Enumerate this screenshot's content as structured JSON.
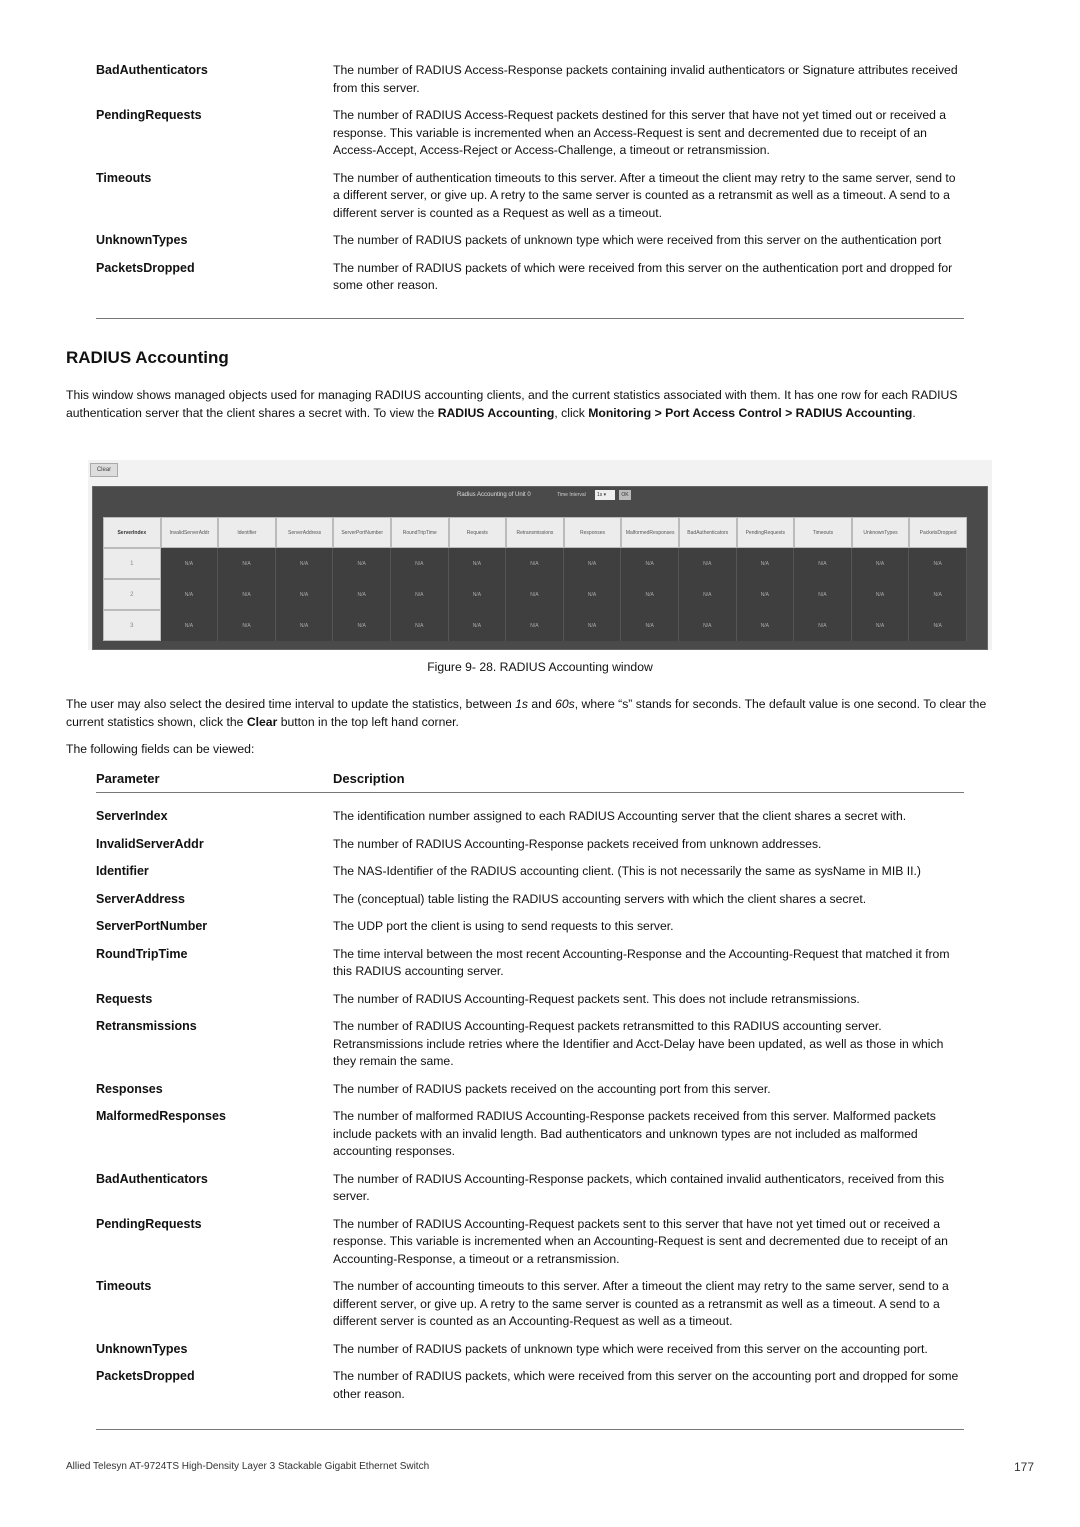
{
  "top_params": [
    {
      "name": "BadAuthenticators",
      "desc": "The number of RADIUS Access-Response packets containing invalid authenticators or Signature attributes received from this server."
    },
    {
      "name": "PendingRequests",
      "desc": "The number of RADIUS Access-Request packets destined for this server that have not yet timed out or received a response. This variable is incremented when an Access-Request is sent and decremented due to receipt of an Access-Accept, Access-Reject or Access-Challenge, a timeout or retransmission."
    },
    {
      "name": "Timeouts",
      "desc": "The number of authentication timeouts to this server. After a timeout the client may retry to the same server, send to a different server, or give up. A retry to the same server is counted as a retransmit as well as a timeout. A send to a different server is counted as a Request as well as a timeout."
    },
    {
      "name": "UnknownTypes",
      "desc": "The number of RADIUS packets of unknown type which were received from this server on the authentication port"
    },
    {
      "name": "PacketsDropped",
      "desc": "The number of RADIUS packets of which were received from this server on the authentication port and dropped for some other reason."
    }
  ],
  "section": {
    "title": "RADIUS Accounting",
    "intro_1": "This window shows managed objects used for managing RADIUS accounting clients, and the current statistics associated with them. It has one row for each RADIUS authentication server that the client shares a secret with. To view the ",
    "intro_b1": "RADIUS Accounting",
    "intro_2": ", click ",
    "intro_b2": "Monitoring > Port Access Control > RADIUS Accounting",
    "intro_3": "."
  },
  "figure": {
    "clear_label": "Clear",
    "panel_title": "Radius Accounting of Unit 0",
    "interval_label": "Time Interval",
    "interval_value": "1s",
    "ok_label": "OK",
    "columns": [
      "ServerIndex",
      "InvalidServerAddr",
      "Identifier",
      "ServerAddress",
      "ServerPortNumber",
      "RoundTripTime",
      "Requests",
      "Retransmissions",
      "Responses",
      "MalformedResponses",
      "BadAuthenticators",
      "PendingRequests",
      "Timeouts",
      "UnknownTypes",
      "PacketsDropped"
    ],
    "rows": [
      {
        "index": "1",
        "values": [
          "N/A",
          "N/A",
          "N/A",
          "N/A",
          "N/A",
          "N/A",
          "N/A",
          "N/A",
          "N/A",
          "N/A",
          "N/A",
          "N/A",
          "N/A",
          "N/A"
        ]
      },
      {
        "index": "2",
        "values": [
          "N/A",
          "N/A",
          "N/A",
          "N/A",
          "N/A",
          "N/A",
          "N/A",
          "N/A",
          "N/A",
          "N/A",
          "N/A",
          "N/A",
          "N/A",
          "N/A"
        ]
      },
      {
        "index": "3",
        "values": [
          "N/A",
          "N/A",
          "N/A",
          "N/A",
          "N/A",
          "N/A",
          "N/A",
          "N/A",
          "N/A",
          "N/A",
          "N/A",
          "N/A",
          "N/A",
          "N/A"
        ]
      }
    ],
    "caption": "Figure 9- 28. RADIUS Accounting window"
  },
  "after": {
    "p1_a": "The user may also select the desired time interval to update the statistics, between ",
    "p1_i1": "1s",
    "p1_b": " and ",
    "p1_i2": "60s",
    "p1_c": ", where “s” stands for seconds. The default value is one second. To clear the current statistics shown, click the ",
    "p1_bold": "Clear",
    "p1_d": " button in the top left hand corner.",
    "p2": "The following fields can be viewed:"
  },
  "table": {
    "header_param": "Parameter",
    "header_desc": "Description",
    "rows": [
      {
        "name": "ServerIndex",
        "desc": "The identification number assigned to each RADIUS Accounting server that the client shares a secret with."
      },
      {
        "name": "InvalidServerAddr",
        "desc": "The number of RADIUS Accounting-Response packets received from unknown addresses."
      },
      {
        "name": "Identifier",
        "desc": "The NAS-Identifier of the RADIUS accounting client. (This is not necessarily the same as sysName in MIB II.)"
      },
      {
        "name": "ServerAddress",
        "desc": "The (conceptual) table listing the RADIUS accounting servers with which the client shares a secret."
      },
      {
        "name": "ServerPortNumber",
        "desc": "The UDP port the client is using to send requests to this server."
      },
      {
        "name": "RoundTripTime",
        "desc": "The time interval between the most recent Accounting-Response and the Accounting-Request that matched it from this RADIUS accounting server."
      },
      {
        "name": "Requests",
        "desc": "The number of RADIUS Accounting-Request packets sent. This does not include retransmissions."
      },
      {
        "name": "Retransmissions",
        "desc": "The number of RADIUS Accounting-Request packets retransmitted to this RADIUS accounting server. Retransmissions include retries where the Identifier and Acct-Delay have been updated, as well as those in which they remain the same."
      },
      {
        "name": "Responses",
        "desc": "The number of RADIUS packets received on the accounting port from this server."
      },
      {
        "name": "MalformedResponses",
        "desc": "The number of malformed RADIUS Accounting-Response packets received from this server. Malformed packets include packets with an invalid length. Bad authenticators and unknown types are not included as malformed accounting responses."
      },
      {
        "name": "BadAuthenticators",
        "desc": "The number of RADIUS Accounting-Response packets, which contained invalid authenticators, received from this server."
      },
      {
        "name": "PendingRequests",
        "desc": "The number of RADIUS Accounting-Request packets sent to this server that have not yet timed out or received a response. This variable is incremented when an Accounting-Request is sent and decremented due to receipt of an Accounting-Response, a timeout or a retransmission."
      },
      {
        "name": "Timeouts",
        "desc": "The number of accounting timeouts to this server. After a timeout the client may retry to the same server, send to a different server, or give up. A retry to the same server is counted as a retransmit as well as a timeout. A send to a different server is counted as an Accounting-Request as well as a timeout."
      },
      {
        "name": "UnknownTypes",
        "desc": "The number of RADIUS packets of unknown type which were received from this server on the accounting port."
      },
      {
        "name": "PacketsDropped",
        "desc": "The number of RADIUS packets, which were received from this server on the accounting port and dropped for some other reason."
      }
    ]
  },
  "footer": {
    "text": "Allied Telesyn AT-9724TS High-Density Layer 3 Stackable Gigabit Ethernet Switch",
    "page": "177"
  }
}
